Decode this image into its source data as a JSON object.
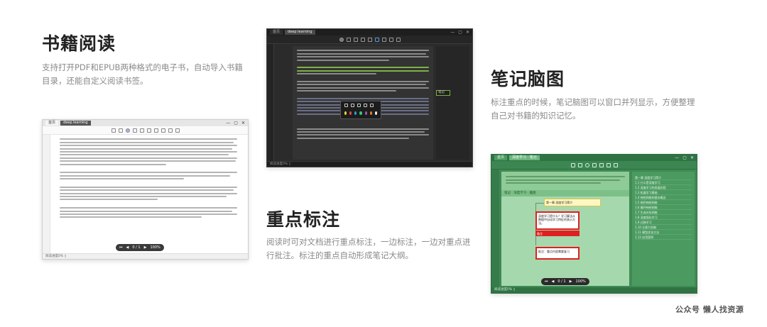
{
  "features": {
    "reading": {
      "title": "书籍阅读",
      "description": "支持打开PDF和EPUB两种格式的电子书，自动导入书籍目录，还能自定义阅读书签。"
    },
    "mindmap": {
      "title": "笔记脑图",
      "description": "标注重点的时候，笔记脑图可以窗口并列显示，方便整理自己对书籍的知识记忆。"
    },
    "highlight": {
      "title": "重点标注",
      "description": "阅读时可对文档进行重点标注，一边标注，一边对重点进行批注。标注的重点自动形成笔记大纲。"
    }
  },
  "screens": {
    "reader": {
      "tab_home": "首页",
      "tab_doc": "deep learning",
      "status": "阅读进度0% ▯",
      "pager_page": "0 / 1",
      "pager_zoom": "100%"
    },
    "highlight": {
      "tab_home": "首页",
      "tab_doc": "deep learning",
      "note_tag": "笔记",
      "status": "阅读进度0% ▯",
      "popup_colors": [
        "#f4d03f",
        "#e74c3c",
        "#3498db",
        "#2ecc71",
        "#9b59b6",
        "#e67e22",
        "#ecf0f1"
      ]
    },
    "mindmap": {
      "tab_home": "首页",
      "tab_doc": "深度学习 · 笔记",
      "map_header": "笔记 · 深度学习 · 脑图",
      "node_root": "第一章 深度学习简介",
      "node_red_1": "深度学习是什么？学习算法从数据中自动学习特征的表示方法。",
      "node_red_2": "备注",
      "node_yellow": "批注：重点内容需要复习",
      "outline_items": [
        "第一章 深度学习简介",
        "1.1 什么是深度学习",
        "1.2 深度学习的发展历程",
        "1.3 机器学习基础",
        "1.4 神经网络的基本概念",
        "1.5 卷积神经网络",
        "1.6 循环神经网络",
        "1.7 生成对抗网络",
        "1.8 深度强化学习",
        "1.9 迁移学习",
        "1.10 注意力机制",
        "1.11 模型优化方法",
        "1.12 应用案例"
      ],
      "status": "阅读进度0% ▯",
      "pager_page": "0 / 1",
      "pager_zoom": "100%"
    }
  },
  "watermark": "公众号 懒人找资源"
}
